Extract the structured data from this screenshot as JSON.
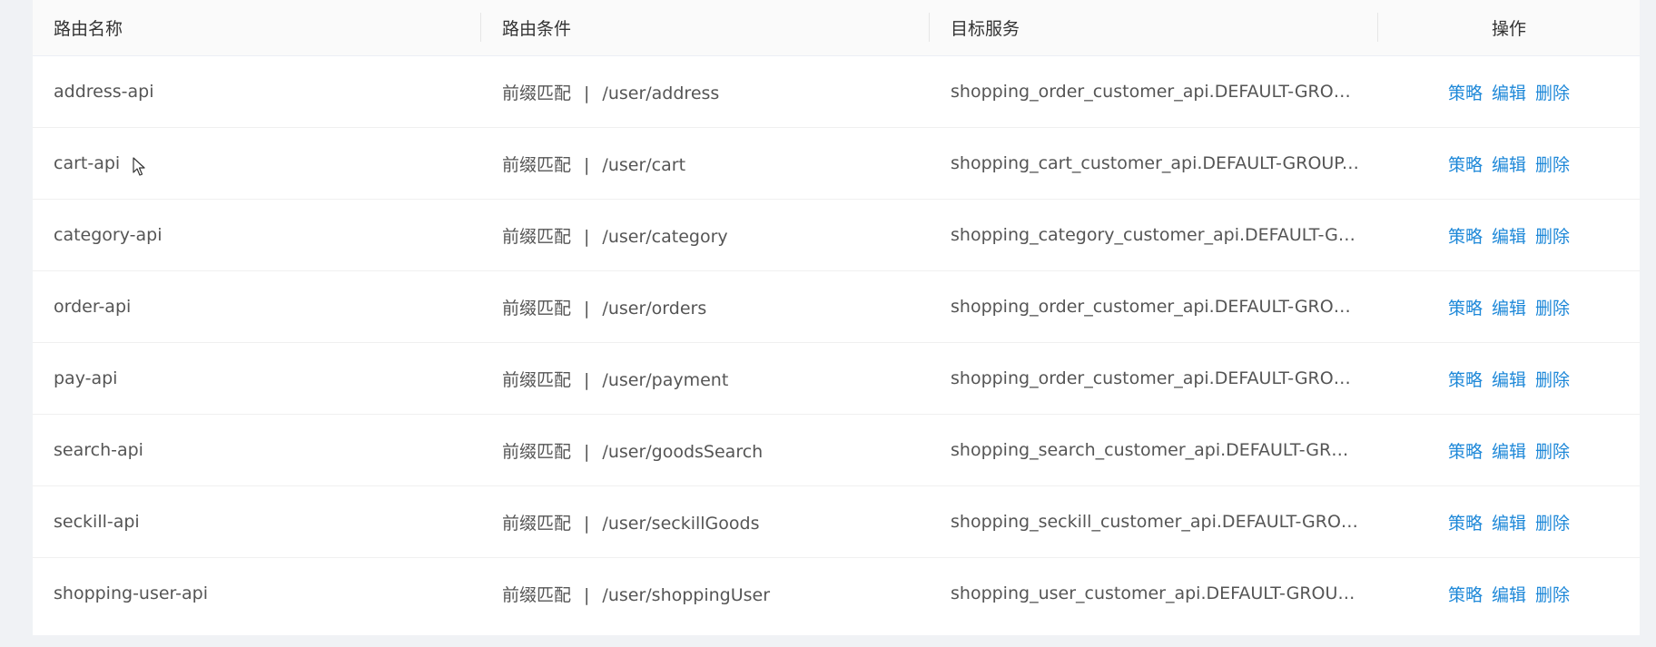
{
  "table": {
    "headers": {
      "name": "路由名称",
      "condition": "路由条件",
      "target": "目标服务",
      "ops": "操作"
    },
    "rows": [
      {
        "name": "address-api",
        "match_type": "前缀匹配",
        "separator": "|",
        "path": "/user/address",
        "target": "shopping_order_customer_api.DEFAULT-GROUP...."
      },
      {
        "name": "cart-api",
        "match_type": "前缀匹配",
        "separator": "|",
        "path": "/user/cart",
        "target": "shopping_cart_customer_api.DEFAULT-GROUP.p..."
      },
      {
        "name": "category-api",
        "match_type": "前缀匹配",
        "separator": "|",
        "path": "/user/category",
        "target": "shopping_category_customer_api.DEFAULT-GRO..."
      },
      {
        "name": "order-api",
        "match_type": "前缀匹配",
        "separator": "|",
        "path": "/user/orders",
        "target": "shopping_order_customer_api.DEFAULT-GROUP...."
      },
      {
        "name": "pay-api",
        "match_type": "前缀匹配",
        "separator": "|",
        "path": "/user/payment",
        "target": "shopping_order_customer_api.DEFAULT-GROUP...."
      },
      {
        "name": "search-api",
        "match_type": "前缀匹配",
        "separator": "|",
        "path": "/user/goodsSearch",
        "target": "shopping_search_customer_api.DEFAULT-GROUP..."
      },
      {
        "name": "seckill-api",
        "match_type": "前缀匹配",
        "separator": "|",
        "path": "/user/seckillGoods",
        "target": "shopping_seckill_customer_api.DEFAULT-GROUP..."
      },
      {
        "name": "shopping-user-api",
        "match_type": "前缀匹配",
        "separator": "|",
        "path": "/user/shoppingUser",
        "target": "shopping_user_customer_api.DEFAULT-GROUP.p..."
      }
    ],
    "actions": {
      "policy": "策略",
      "edit": "编辑",
      "delete": "删除"
    }
  },
  "colors": {
    "link": "#1e88d8",
    "header_bg": "#fafafa",
    "page_bg": "#f0f2f5"
  },
  "icons": {
    "cursor": "mouse-pointer-icon"
  }
}
